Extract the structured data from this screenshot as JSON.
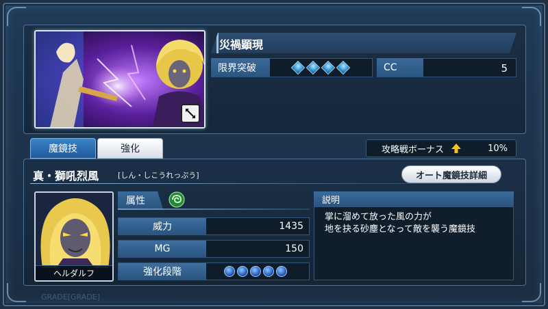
{
  "card": {
    "title": "災禍顕現",
    "limit_break_label": "限界突破",
    "limit_break_gems": 4,
    "cc_label": "CC",
    "cc_value": "5"
  },
  "tabs": [
    {
      "label": "魔鏡技",
      "active": true
    },
    {
      "label": "強化",
      "active": false
    }
  ],
  "bonus": {
    "label": "攻略戦ボーナス",
    "icon": "up-arrow-icon",
    "value": "10%"
  },
  "skill": {
    "name": "真・獅吼烈風",
    "reading": "[しん・しこうれっぷう]",
    "auto_button": "オート魔鏡技詳細",
    "character_name": "ヘルダルフ",
    "attribute_label": "属性",
    "attribute_icon": "wind-icon",
    "stats": [
      {
        "label": "威力",
        "value": "1435"
      },
      {
        "label": "MG",
        "value": "150"
      },
      {
        "label": "強化段階",
        "value": ""
      }
    ],
    "enhance_orbs": 5,
    "description_label": "説明",
    "description_lines": [
      "掌に溜めて放った風の力が",
      "地を抉る砂塵となって敵を襲う魔鏡技"
    ]
  },
  "footer": "GRADE[GRADE]"
}
